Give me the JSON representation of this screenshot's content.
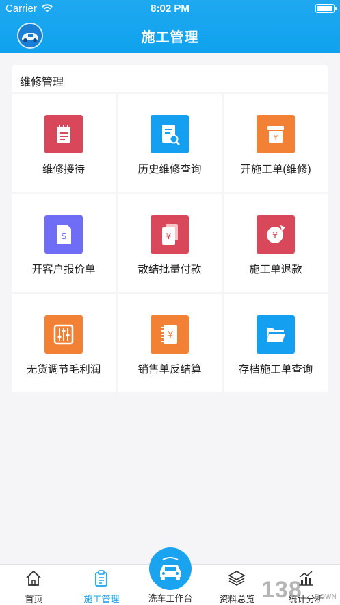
{
  "status_bar": {
    "carrier": "Carrier",
    "time": "8:02 PM"
  },
  "header": {
    "title": "施工管理"
  },
  "section": {
    "title": "维修管理",
    "items": [
      {
        "label": "维修接待",
        "icon": "notepad-icon",
        "color": "#d9485a"
      },
      {
        "label": "历史维修查询",
        "icon": "document-search-icon",
        "color": "#159ff0"
      },
      {
        "label": "开施工单(维修)",
        "icon": "box-yuan-icon",
        "color": "#f28135"
      },
      {
        "label": "开客户报价单",
        "icon": "document-dollar-icon",
        "color": "#6f6cf5"
      },
      {
        "label": "散结批量付款",
        "icon": "stacked-bills-yuan-icon",
        "color": "#d9485a"
      },
      {
        "label": "施工单退款",
        "icon": "refund-yuan-icon",
        "color": "#d9485a"
      },
      {
        "label": "无货调节毛利润",
        "icon": "sliders-icon",
        "color": "#f28135"
      },
      {
        "label": "销售单反结算",
        "icon": "receipt-yuan-icon",
        "color": "#f28135"
      },
      {
        "label": "存档施工单查询",
        "icon": "folder-icon",
        "color": "#159ff0"
      }
    ]
  },
  "tabbar": {
    "items": [
      {
        "label": "首页",
        "icon": "home-icon",
        "active": false
      },
      {
        "label": "施工管理",
        "icon": "clipboard-icon",
        "active": true
      },
      {
        "label": "洗车工作台",
        "icon": "car-wash-icon",
        "active": false
      },
      {
        "label": "资料总览",
        "icon": "layers-icon",
        "active": false
      },
      {
        "label": "统计分析",
        "icon": "chart-icon",
        "active": false
      }
    ],
    "accent": "#1aa3ee"
  },
  "watermark": {
    "big": "138",
    "small": "DOWN"
  }
}
